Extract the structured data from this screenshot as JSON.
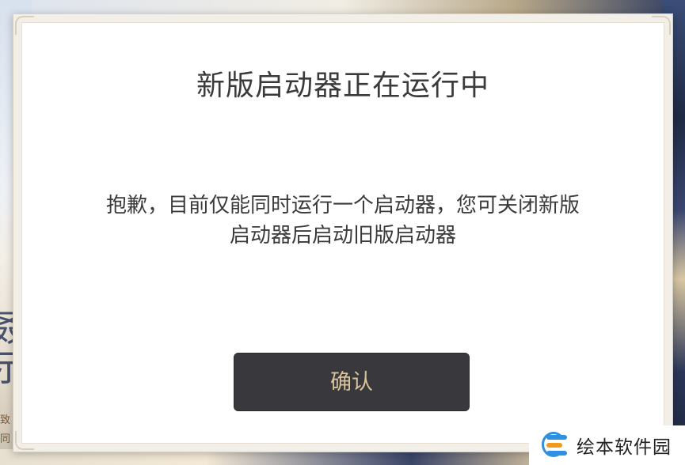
{
  "background": {
    "left_text": "叒\n示",
    "left_small": "致\n同"
  },
  "dialog": {
    "title": "新版启动器正在运行中",
    "message_lines": [
      "抱歉，目前仅能同时运行一个启动器，您可关闭新版",
      "启动器后启动旧版启动器"
    ],
    "confirm_label": "确认"
  },
  "watermark": {
    "text": "绘本软件园",
    "icon": "watermark-logo-icon"
  },
  "colors": {
    "button_bg": "#38383d",
    "button_text": "#d9c39a",
    "dialog_bg": "#ffffff",
    "text": "#3a3a3a"
  }
}
